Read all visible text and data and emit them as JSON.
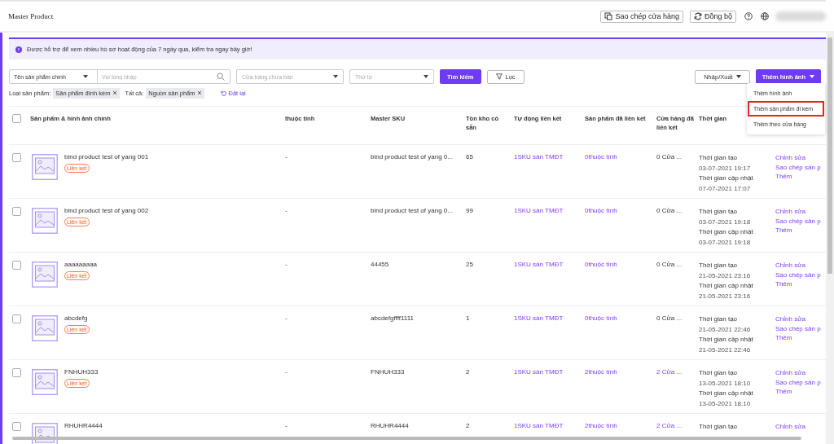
{
  "header": {
    "title": "Master Product",
    "buttons": [
      {
        "kind": "copy",
        "label": "Sao chép cửa hàng"
      },
      {
        "kind": "sync",
        "label": "Đồng bộ"
      }
    ]
  },
  "banner": {
    "text": "Được hỗ trợ để xem nhiều hồ sơ hoạt động của 7 ngày qua, kiểm tra ngay bây giờ!"
  },
  "filters": {
    "field_select": "Tên sản phẩm chính",
    "search": {
      "placeholder": "Vui lòng nhập"
    },
    "store_select": {
      "placeholder": "Cửa hàng chưa bán"
    },
    "order_select": {
      "placeholder": "Thứ tự"
    },
    "search_button": "Tìm kiếm",
    "filter_button": "Lọc",
    "import_export": "Nhập/Xuất",
    "add_image": "Thêm hình ảnh"
  },
  "tags": [
    {
      "label": "Loại sản phẩm:",
      "value": "Sản phẩm đính kèm"
    },
    {
      "label": "Tất cả:",
      "value": "Nguồn sản phẩm"
    }
  ],
  "reset": "Đặt lại",
  "menu": [
    {
      "label": "Thêm hình ảnh",
      "highlighted": false
    },
    {
      "label": "Thêm sản phẩm đi kèm",
      "highlighted": true
    },
    {
      "label": "Thêm theo cửa hàng",
      "highlighted": false
    }
  ],
  "table": {
    "all_checked": false,
    "columns": [
      "Sản phẩm & hình ảnh chính",
      "thuộc tính",
      "Master SKU",
      "Tồn kho có sẵn",
      "Tự động liên kết",
      "Sản phẩm đã liên kết",
      "Cửa hàng đã liên kết",
      "Thời gian"
    ],
    "rows": [
      {
        "checked": false,
        "name": "bind product test of yang 001",
        "badge": "Liên kết",
        "attribute": "-",
        "sku": "bind product test of yang 0...",
        "stock": "65",
        "auto_link": "1SKU sàn TMĐT",
        "linked_products": "0thuộc tính",
        "linked_stores": {
          "text": "0 Cửa ...",
          "link": false
        },
        "times": [
          {
            "label": "Thời gian tạo",
            "value": "03-07-2021 19:17"
          },
          {
            "label": "Thời gian cập nhật",
            "value": "07-07-2021 17:07"
          }
        ],
        "actions": [
          "Chỉnh sửa",
          "Sao chép sản p",
          "Thêm"
        ]
      },
      {
        "checked": false,
        "name": "bind product test of yang 002",
        "badge": "Liên kết",
        "attribute": "-",
        "sku": "bind product test of yang 0...",
        "stock": "99",
        "auto_link": "1SKU sàn TMĐT",
        "linked_products": "0thuộc tính",
        "linked_stores": {
          "text": "0 Cửa ...",
          "link": false
        },
        "times": [
          {
            "label": "Thời gian tạo",
            "value": "03-07-2021 19:18"
          },
          {
            "label": "Thời gian cập nhật",
            "value": "03-07-2021 19:18"
          }
        ],
        "actions": [
          "Chỉnh sửa",
          "Sao chép sản p",
          "Thêm"
        ]
      },
      {
        "checked": false,
        "name": "aaaaaaaaa",
        "badge": "Liên kết",
        "attribute": "-",
        "sku": "44455",
        "stock": "25",
        "auto_link": "1SKU sàn TMĐT",
        "linked_products": "0thuộc tính",
        "linked_stores": {
          "text": "0 Cửa ...",
          "link": false
        },
        "times": [
          {
            "label": "Thời gian tạo",
            "value": "21-05-2021 23:16"
          },
          {
            "label": "Thời gian cập nhật",
            "value": "21-05-2021 23:16"
          }
        ],
        "actions": [
          "Chỉnh sửa",
          "Sao chép sản p",
          "Thêm"
        ]
      },
      {
        "checked": false,
        "name": "abcdefg",
        "badge": "Liên kết",
        "attribute": "-",
        "sku": "abcdefgffff1111",
        "stock": "1",
        "auto_link": "1SKU sàn TMĐT",
        "linked_products": "0thuộc tính",
        "linked_stores": {
          "text": "0 Cửa ...",
          "link": false
        },
        "times": [
          {
            "label": "Thời gian tạo",
            "value": "21-05-2021 22:46"
          },
          {
            "label": "Thời gian cập nhật",
            "value": "21-05-2021 22:46"
          }
        ],
        "actions": [
          "Chỉnh sửa",
          "Sao chép sản p",
          "Thêm"
        ]
      },
      {
        "checked": false,
        "name": "FNHUH333",
        "badge": "Liên kết",
        "attribute": "-",
        "sku": "FNHUH333",
        "stock": "2",
        "auto_link": "1SKU sàn TMĐT",
        "linked_products": "2thuộc tính",
        "linked_stores": {
          "text": "2 Cửa ...",
          "link": true
        },
        "times": [
          {
            "label": "Thời gian tạo",
            "value": "13-05-2021 18:10"
          },
          {
            "label": "Thời gian cập nhật",
            "value": "13-05-2021 18:10"
          }
        ],
        "actions": [
          "Chỉnh sửa",
          "Sao chép sản p",
          "Thêm"
        ]
      },
      {
        "checked": false,
        "name": "RHUHR4444",
        "attribute": "-",
        "sku": "RHUHR4444",
        "stock": "2",
        "auto_link": "1SKU sàn TMĐT",
        "linked_products": "2thuộc tính",
        "linked_stores": {
          "text": "2 Cửa ...",
          "link": true
        },
        "times": [
          {
            "label": "Thời gian tạo"
          }
        ],
        "actions": [
          "Chỉnh sửa"
        ]
      }
    ]
  }
}
